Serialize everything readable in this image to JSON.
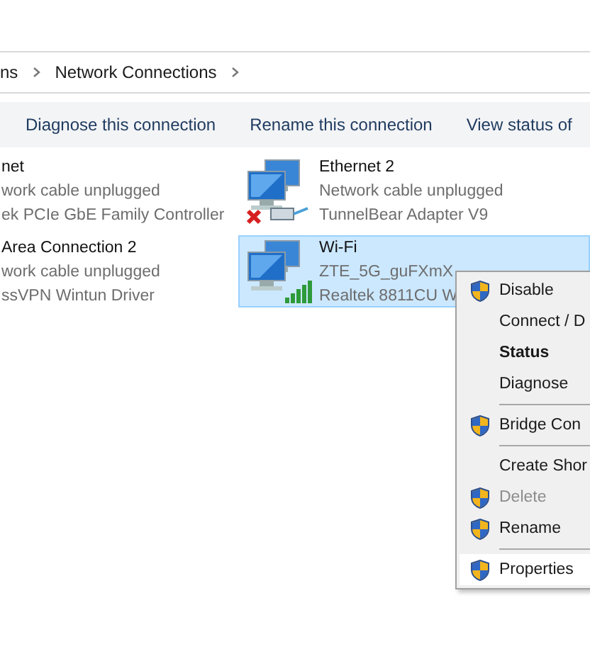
{
  "breadcrumb": [
    "ns",
    "Network Connections"
  ],
  "toolbar": [
    "Diagnose this connection",
    "Rename this connection",
    "View status of"
  ],
  "connections": [
    {
      "kind": "clipped",
      "name": "net",
      "status": "work cable unplugged",
      "device": "ek PCIe GbE Family Controller",
      "selected": false
    },
    {
      "kind": "ethernet",
      "name": "Ethernet 2",
      "status": "Network cable unplugged",
      "device": "TunnelBear Adapter V9",
      "selected": false
    },
    {
      "kind": "clipped",
      "name": "Area Connection 2",
      "status": "work cable unplugged",
      "device": "ssVPN Wintun Driver",
      "selected": false
    },
    {
      "kind": "wifi",
      "name": "Wi-Fi",
      "status": "ZTE_5G_guFXmX",
      "device": "Realtek 8811CU W",
      "selected": true
    }
  ],
  "context_menu": [
    {
      "kind": "item",
      "label": "Disable",
      "shield": true,
      "bold": false,
      "disabled": false,
      "selected": false
    },
    {
      "kind": "item",
      "label": "Connect / D",
      "shield": false,
      "bold": false,
      "disabled": false,
      "selected": false
    },
    {
      "kind": "item",
      "label": "Status",
      "shield": false,
      "bold": true,
      "disabled": false,
      "selected": false
    },
    {
      "kind": "item",
      "label": "Diagnose",
      "shield": false,
      "bold": false,
      "disabled": false,
      "selected": false
    },
    {
      "kind": "separator"
    },
    {
      "kind": "item",
      "label": "Bridge Con",
      "shield": true,
      "bold": false,
      "disabled": false,
      "selected": false
    },
    {
      "kind": "separator"
    },
    {
      "kind": "item",
      "label": "Create Shor",
      "shield": false,
      "bold": false,
      "disabled": false,
      "selected": false
    },
    {
      "kind": "item",
      "label": "Delete",
      "shield": true,
      "bold": false,
      "disabled": true,
      "selected": false
    },
    {
      "kind": "item",
      "label": "Rename",
      "shield": true,
      "bold": false,
      "disabled": false,
      "selected": false
    },
    {
      "kind": "separator"
    },
    {
      "kind": "item",
      "label": "Properties",
      "shield": true,
      "bold": false,
      "disabled": false,
      "selected": true
    }
  ]
}
